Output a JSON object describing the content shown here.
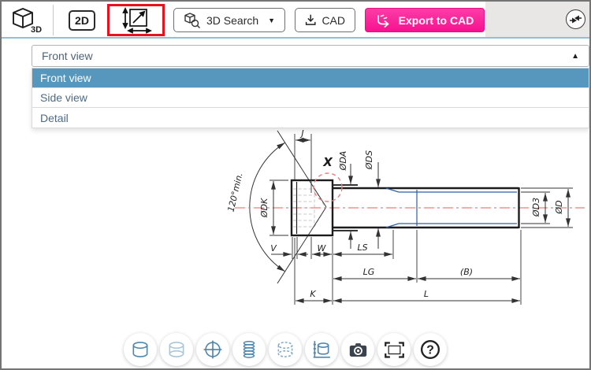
{
  "toolbar": {
    "logo_label": "3D",
    "view_2d_label": "2D",
    "search_label": "3D Search",
    "search_caret": "▼",
    "cad_label": "CAD",
    "export_label": "Export to CAD",
    "accent_pink": "#f81190",
    "highlight_red": "#e6131f"
  },
  "view_select": {
    "value": "Front view",
    "caret": "▲",
    "selected_bg": "#5797bd",
    "options": [
      {
        "label": "Front view",
        "selected": true
      },
      {
        "label": "Side view",
        "selected": false
      },
      {
        "label": "Detail",
        "selected": false
      }
    ]
  },
  "drawing": {
    "labels": {
      "angle": "120°min.",
      "j": "J",
      "x": "X",
      "dk": "ØDK",
      "da": "ØDA",
      "ds": "ØDS",
      "d3": "ØD3",
      "d": "ØD",
      "v": "V",
      "w": "W",
      "ls": "LS",
      "lg": "LG",
      "b": "(B)",
      "k": "K",
      "l": "L"
    },
    "colors": {
      "outline": "#1c1c1c",
      "dimension": "#333333",
      "centerline": "#e88080",
      "detail_circle": "#e88080",
      "thread": "#2e5fa3",
      "hidden": "#c8c8c8"
    }
  },
  "bottom_toolbar": {
    "help_glyph": "?",
    "icons": [
      "solid-view",
      "transparent-view",
      "axes-view",
      "thread-view",
      "hidden-lines-view",
      "dimensions-view",
      "screenshot",
      "fit-to-screen",
      "help"
    ]
  }
}
